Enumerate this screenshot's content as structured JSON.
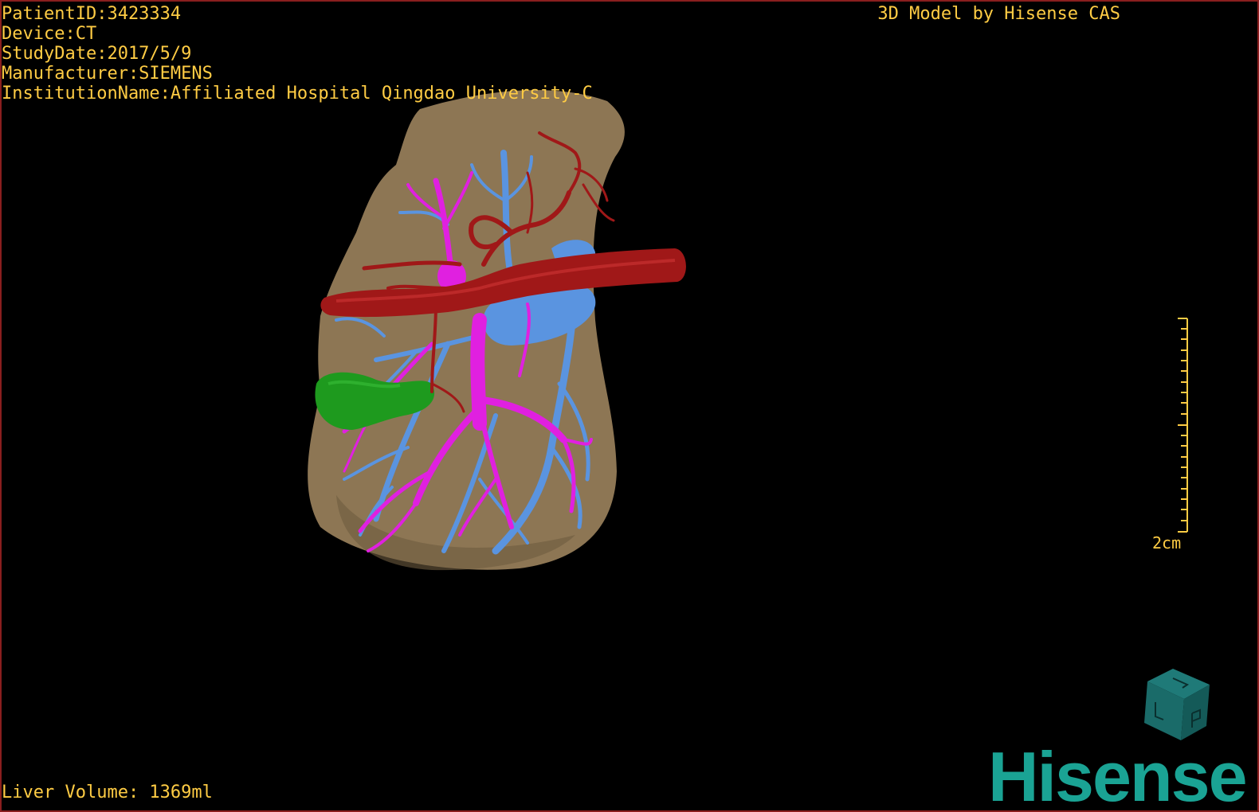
{
  "viewer": {
    "credit": "3D Model by Hisense CAS",
    "volume": "Liver Volume: 1369ml"
  },
  "dicom": {
    "patient_id": "PatientID:3423334",
    "device": "Device:CT",
    "study_date": "StudyDate:2017/5/9",
    "manufacturer": "Manufacturer:SIEMENS",
    "institution": "InstitutionName:Affiliated Hospital Qingdao University-C"
  },
  "scale": {
    "label": "2cm"
  },
  "logo": {
    "text": "Hisense"
  },
  "colors": {
    "overlay_text": "#ffcc44",
    "liver": "#8d7654",
    "artery": "#a01818",
    "portal_vein": "#e020e0",
    "hepatic_vein": "#5a94e0",
    "gallbladder": "#1e9a1e",
    "brand": "#1aa394",
    "frame": "#8a1e1e"
  },
  "icons": {
    "orientation_cube": "orientation-cube-icon",
    "scale_bar": "ruler-icon"
  }
}
